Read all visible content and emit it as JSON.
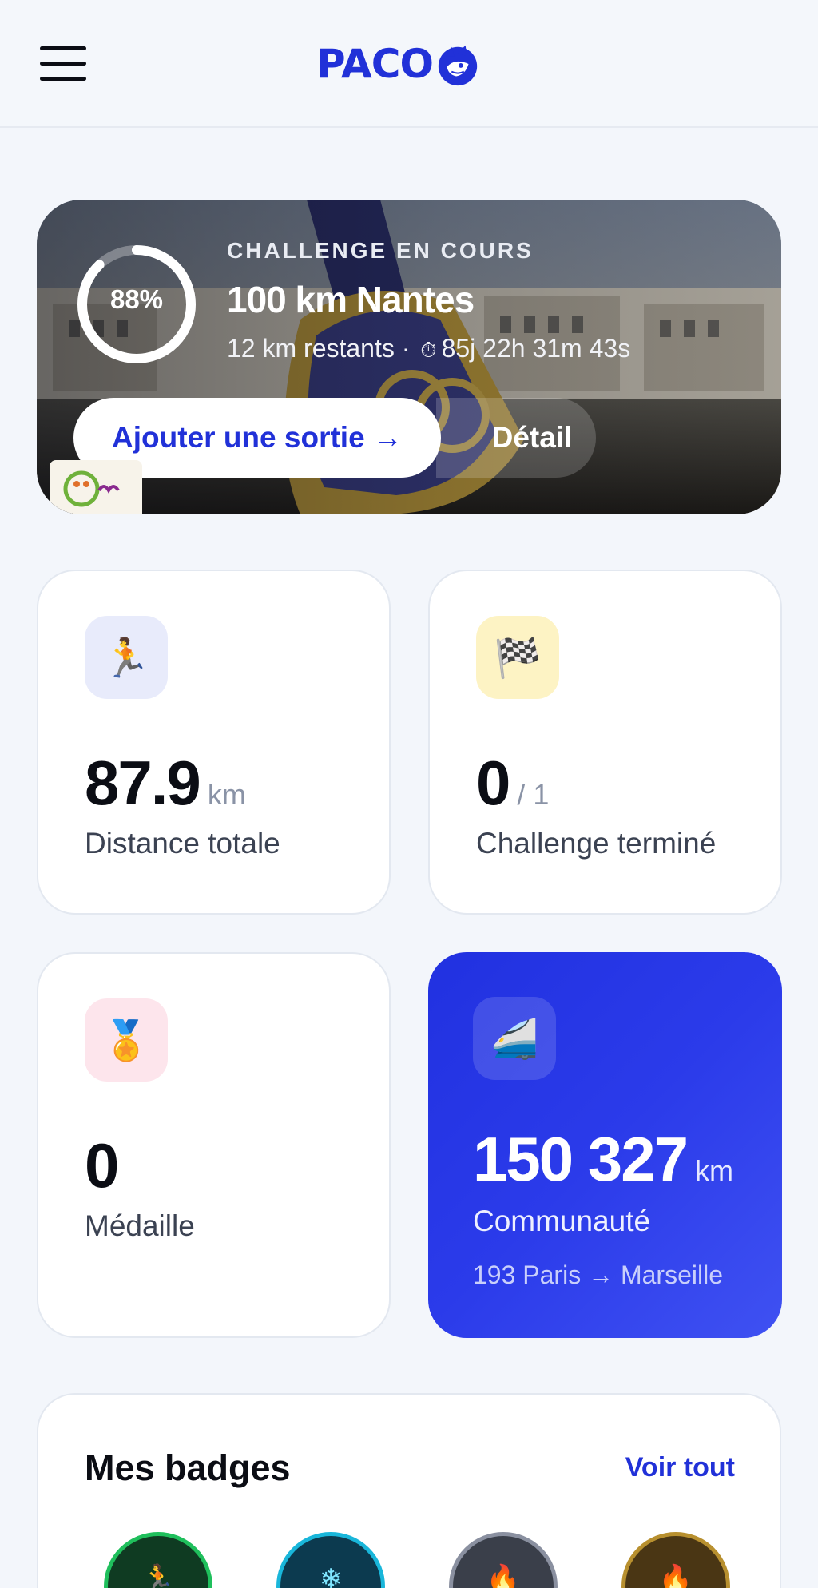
{
  "header": {
    "menu_icon": "hamburger-menu-icon",
    "logo_text": "PACO",
    "logo_icon": "dog-head-logo-icon",
    "brand_color": "#2131d8"
  },
  "hero": {
    "progress_percent": 88,
    "progress_label": "88%",
    "kicker": "CHALLENGE EN COURS",
    "title": "100 km Nantes",
    "remaining": "12 km restants",
    "separator": "·",
    "timer_icon": "stopwatch-icon",
    "countdown": "85j 22h 31m 43s",
    "add_button": "Ajouter une sortie →",
    "detail_button": "Détail"
  },
  "stats": {
    "distance": {
      "icon": "runner-icon",
      "value": "87.9",
      "unit": "km",
      "label": "Distance totale"
    },
    "challenges": {
      "icon": "checkered-flag-icon",
      "value": "0",
      "unit": "/ 1",
      "label": "Challenge terminé"
    },
    "medals": {
      "icon": "medal-icon",
      "value": "0",
      "label": "Médaille"
    },
    "community": {
      "icon": "high-speed-train-icon",
      "value": "150 327",
      "unit": "km",
      "label": "Communauté",
      "note": "193 Paris → Marseille"
    }
  },
  "badges": {
    "title": "Mes badges",
    "link": "Voir tout",
    "items": [
      {
        "icon": "runner-badge-icon",
        "color": "#1fbf5c"
      },
      {
        "icon": "snowflake-badge-icon",
        "color": "#19b6da"
      },
      {
        "icon": "flame-badge-icon",
        "color": "#8a90a0"
      },
      {
        "icon": "flame-badge-icon",
        "color": "#b8902f"
      }
    ]
  }
}
